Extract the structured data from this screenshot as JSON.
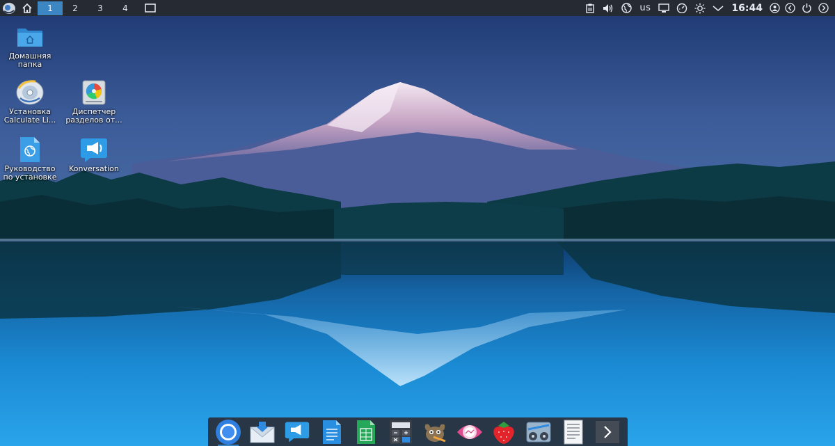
{
  "panel": {
    "workspaces": [
      "1",
      "2",
      "3",
      "4"
    ],
    "active_workspace": "1",
    "keyboard_layout": "us",
    "clock": "16:44",
    "bg_color": "#262b33",
    "accent": "#3d86c4"
  },
  "desktop": {
    "icons": [
      {
        "label": "Домашняя\nпапка",
        "icon": "home-folder-icon"
      },
      {
        "label": "Установка\nCalculate Li...",
        "icon": "installer-disc-icon"
      },
      {
        "label": "Диспетчер\nразделов от...",
        "icon": "partition-manager-icon"
      },
      {
        "label": "Руководство\nпо установке",
        "icon": "install-guide-icon"
      },
      {
        "label": "Konversation",
        "icon": "konversation-icon"
      }
    ]
  },
  "dock": {
    "items": [
      {
        "icon": "chromium-icon"
      },
      {
        "icon": "mail-client-icon"
      },
      {
        "icon": "konversation-icon"
      },
      {
        "icon": "text-document-icon"
      },
      {
        "icon": "spreadsheet-icon"
      },
      {
        "icon": "calculator-icon"
      },
      {
        "icon": "gimp-icon"
      },
      {
        "icon": "image-viewer-icon"
      },
      {
        "icon": "strawberry-player-icon"
      },
      {
        "icon": "media-tool-icon"
      },
      {
        "icon": "text-editor-icon"
      },
      {
        "icon": "more-arrow-icon"
      }
    ]
  }
}
